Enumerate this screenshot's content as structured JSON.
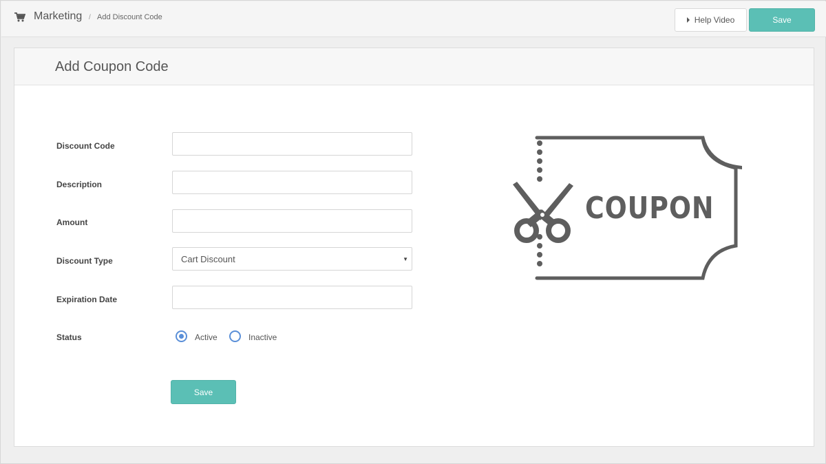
{
  "breadcrumb": {
    "section": "Marketing",
    "separator": "/",
    "current": "Add Discount Code"
  },
  "toolbar": {
    "help_label": "Help Video",
    "save_label": "Save"
  },
  "panel": {
    "title": "Add Coupon Code"
  },
  "form": {
    "discount_code": {
      "label": "Discount Code",
      "value": "",
      "placeholder": ""
    },
    "description": {
      "label": "Description",
      "value": "",
      "placeholder": ""
    },
    "amount": {
      "label": "Amount",
      "value": "",
      "placeholder": ""
    },
    "discount_type": {
      "label": "Discount Type",
      "selected": "Cart Discount"
    },
    "expiration_date": {
      "label": "Expiration Date",
      "value": "",
      "placeholder": ""
    },
    "status": {
      "label": "Status",
      "options": [
        "Active",
        "Inactive"
      ],
      "selected": "Active"
    },
    "save_label": "Save"
  },
  "illustration": {
    "text": "COUPON",
    "icon": "scissors-coupon-icon"
  },
  "icons": {
    "breadcrumb": "shopping-cart-icon",
    "help": "play-triangle-icon",
    "select": "caret-down-icon"
  },
  "colors": {
    "accent": "#5bbfb5",
    "radio": "#5a8fd8",
    "illustration": "#5e5e5e"
  }
}
